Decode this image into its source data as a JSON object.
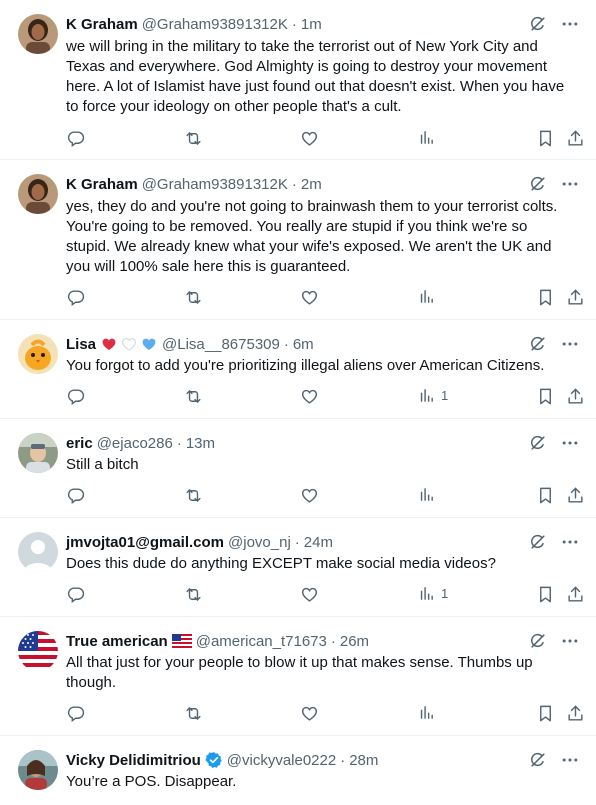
{
  "tweets": [
    {
      "name": "K Graham",
      "handle": "@Graham93891312K",
      "time": "1m",
      "text": "we will bring in the military to take the terrorist out of New York City and Texas and everywhere. God Almighty is going to destroy your movement here. A lot of Islamist have just found out that doesn't exist. When you have to force your ideology on other people that's a cult.",
      "views": ""
    },
    {
      "name": "K Graham",
      "handle": "@Graham93891312K",
      "time": "2m",
      "text": "yes, they do and you're not going to brainwash them to your terrorist colts. You're going to be removed. You really are stupid if you think we're so stupid. We already knew what your wife's exposed. We aren't the UK and you will 100% sale here this is guaranteed.",
      "views": ""
    },
    {
      "name": "Lisa",
      "name_emoji": [
        "red-heart",
        "white-heart",
        "blue-heart"
      ],
      "handle": "@Lisa__8675309",
      "time": "6m",
      "text": "You forgot to add you're prioritizing illegal aliens over American Citizens.",
      "views": "1"
    },
    {
      "name": "eric",
      "handle": "@ejaco286",
      "time": "13m",
      "text": "Still a bitch",
      "views": ""
    },
    {
      "name": "jmvojta01@gmail.com",
      "handle": "@jovo_nj",
      "time": "24m",
      "text": "Does this dude do anything EXCEPT make social media videos?",
      "views": "1"
    },
    {
      "name": "True american",
      "name_emoji": [
        "us-flag"
      ],
      "handle": "@american_t71673",
      "time": "26m",
      "text": "All that just for your people to blow it up that makes sense. Thumbs up though.",
      "views": ""
    },
    {
      "name": "Vicky Delidimitriou",
      "verified": true,
      "handle": "@vickyvale0222",
      "time": "28m",
      "text": "You’re a POS. Disappear.",
      "views": ""
    }
  ],
  "separator": "·",
  "colors": {
    "text": "#0f1419",
    "secondary": "#536471",
    "border": "#eff3f4",
    "verified": "#1d9bf0"
  }
}
